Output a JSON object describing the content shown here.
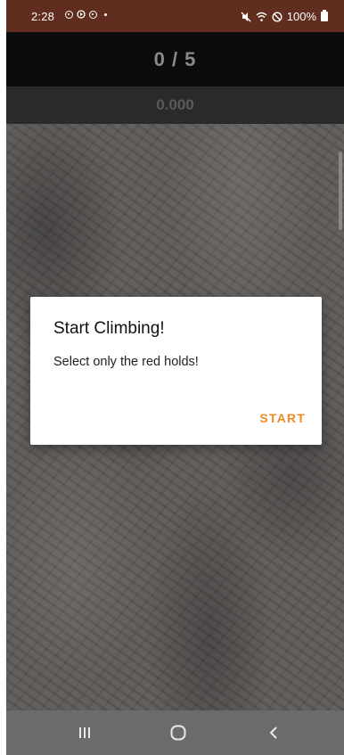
{
  "status_bar": {
    "time": "2:28",
    "battery_percent": "100%",
    "icons": [
      "record-icon",
      "play-icon",
      "record-icon",
      "dot-icon",
      "mute-icon",
      "wifi-icon",
      "blocked-icon",
      "battery-icon"
    ]
  },
  "game": {
    "score": "0 / 5",
    "timer": "0.000"
  },
  "dialog": {
    "title": "Start Climbing!",
    "message": "Select only the red holds!",
    "button_label": "START"
  },
  "navigation": {
    "buttons": [
      "recent-apps-icon",
      "home-icon",
      "back-icon"
    ]
  },
  "colors": {
    "status_bar": "#612d1f",
    "accent": "#f08a24",
    "score_bar": "#0c0c0c",
    "timer_bar": "#2a2a2a",
    "nav_bar": "#6b6b6b"
  }
}
